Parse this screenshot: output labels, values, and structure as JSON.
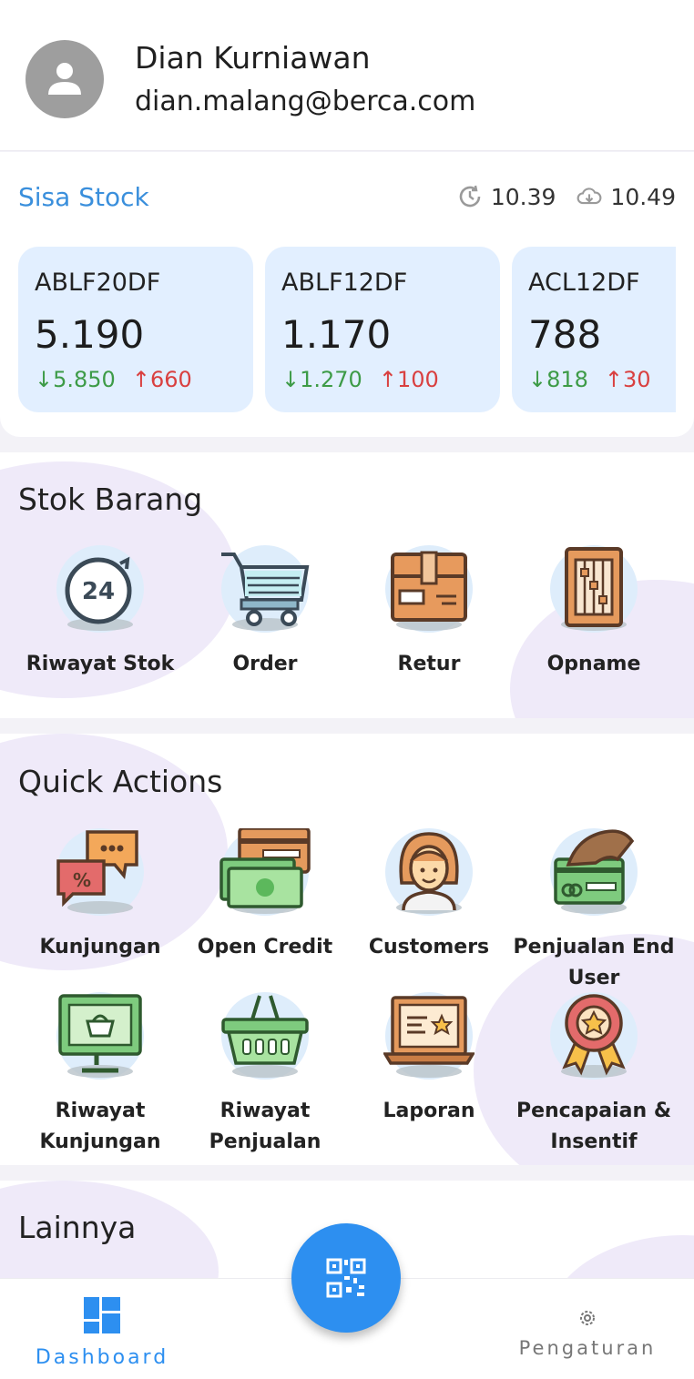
{
  "user": {
    "name": "Dian Kurniawan",
    "email": "dian.malang@berca.com",
    "avatar_icon": "person-icon"
  },
  "stock": {
    "title": "Sisa Stock",
    "last_update": "10.39",
    "last_sync": "10.49",
    "cards": [
      {
        "code": "ABLF20DF",
        "qty": "5.190",
        "down": "5.850",
        "up": "660"
      },
      {
        "code": "ABLF12DF",
        "qty": "1.170",
        "down": "1.270",
        "up": "100"
      },
      {
        "code": "ACL12DF",
        "qty": "788",
        "down": "818",
        "up": "30"
      }
    ]
  },
  "stok_barang": {
    "title": "Stok Barang",
    "items": [
      {
        "label": "Riwayat Stok",
        "icon": "history-24-icon"
      },
      {
        "label": "Order",
        "icon": "cart-icon"
      },
      {
        "label": "Retur",
        "icon": "box-icon"
      },
      {
        "label": "Opname",
        "icon": "abacus-icon"
      }
    ]
  },
  "quick_actions": {
    "title": "Quick Actions",
    "items": [
      {
        "label": "Kunjungan",
        "icon": "chat-bubbles-icon"
      },
      {
        "label": "Open Credit",
        "icon": "money-card-icon"
      },
      {
        "label": "Customers",
        "icon": "customer-icon"
      },
      {
        "label": "Penjualan End User",
        "icon": "card-payment-icon"
      },
      {
        "label": "Riwayat Kunjungan",
        "icon": "monitor-shop-icon"
      },
      {
        "label": "Riwayat Penjualan",
        "icon": "basket-icon"
      },
      {
        "label": "Laporan",
        "icon": "laptop-report-icon"
      },
      {
        "label": "Pencapaian & Insentif",
        "icon": "award-badge-icon"
      }
    ]
  },
  "lainnya": {
    "title": "Lainnya"
  },
  "fab": {
    "icon": "qr-code-icon"
  },
  "nav": {
    "dashboard": "Dashboard",
    "settings": "Pengaturan"
  },
  "colors": {
    "accent": "#2d8ff0",
    "card_bg": "#e2efff",
    "down": "#3d9b47",
    "up": "#d94040"
  }
}
